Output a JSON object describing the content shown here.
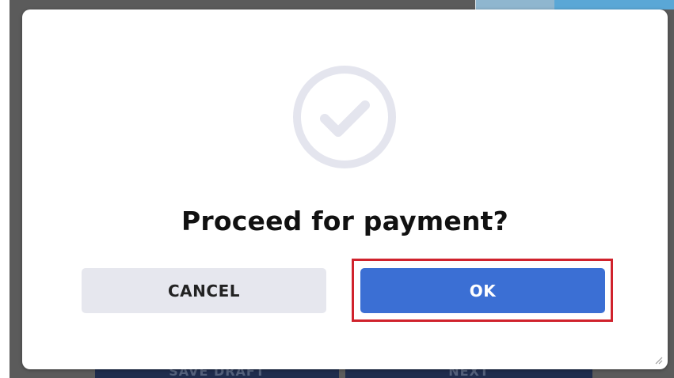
{
  "background": {
    "save_draft_label": "SAVE DRAFT",
    "next_label": "NEXT"
  },
  "modal": {
    "icon": "check-circle-icon",
    "title": "Proceed for payment?",
    "cancel_label": "CANCEL",
    "ok_label": "OK",
    "highlighted_button": "OK"
  },
  "colors": {
    "ok_button": "#3b6fd4",
    "cancel_button": "#e6e7ee",
    "highlight": "#d0222c",
    "icon": "#e4e5ee"
  }
}
